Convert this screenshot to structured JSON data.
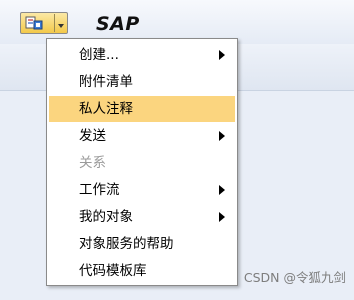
{
  "header": {
    "title": "SAP",
    "gos_button_icon": "services-for-object-icon"
  },
  "context_menu": {
    "items": [
      {
        "label": "创建...",
        "has_submenu": true,
        "enabled": true,
        "highlighted": false
      },
      {
        "label": "附件清单",
        "has_submenu": false,
        "enabled": true,
        "highlighted": false
      },
      {
        "label": "私人注释",
        "has_submenu": false,
        "enabled": true,
        "highlighted": true
      },
      {
        "label": "发送",
        "has_submenu": true,
        "enabled": true,
        "highlighted": false
      },
      {
        "label": "关系",
        "has_submenu": false,
        "enabled": false,
        "highlighted": false
      },
      {
        "label": "工作流",
        "has_submenu": true,
        "enabled": true,
        "highlighted": false
      },
      {
        "label": "我的对象",
        "has_submenu": true,
        "enabled": true,
        "highlighted": false
      },
      {
        "label": "对象服务的帮助",
        "has_submenu": false,
        "enabled": true,
        "highlighted": false
      },
      {
        "label": "代码模板库",
        "has_submenu": false,
        "enabled": true,
        "highlighted": false
      }
    ]
  },
  "watermark": "CSDN @令狐九剑",
  "colors": {
    "highlight": "#fbd57f",
    "disabled_text": "#9a9a9a",
    "background": "#e9eef7"
  }
}
